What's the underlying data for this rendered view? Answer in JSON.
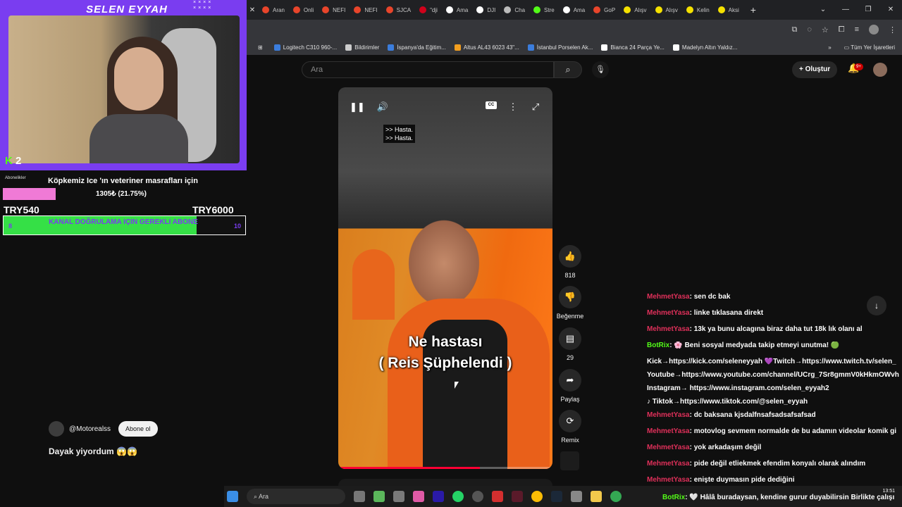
{
  "browser": {
    "tabs": [
      "Aran",
      "Onli",
      "NEFI",
      "NEFI",
      "SJCA",
      "\"dji",
      "Ama",
      "DJI",
      "Cha",
      "Stre",
      "Ama",
      "GoP",
      "Alışv",
      "Alışv",
      "Kelin",
      "Aksi"
    ],
    "tab_colors": [
      "#e8452b",
      "#e8452b",
      "#e8452b",
      "#e8452b",
      "#e8452b",
      "#d0021b",
      "#ffffff",
      "#ffffff",
      "#bbbbbb",
      "#53fc18",
      "#ffffff",
      "#e8452b",
      "#f5e100",
      "#f5e100",
      "#f5e100",
      "#f5e100"
    ],
    "new_tab": "+",
    "bookmarks": [
      "Logitech C310 960-...",
      "Bildirimler",
      "İspanya'da Eğitim...",
      "Altus AL43 6023 43\"...",
      "İstanbul Porselen Ak...",
      "Bianca 24 Parça Ye...",
      "Madelyn Altın Yaldız..."
    ],
    "bookmark_colors": [
      "#3b7ddd",
      "#cccccc",
      "#3b7ddd",
      "#f29e1f",
      "#3b7ddd",
      "#ffffff",
      "#ffffff"
    ],
    "all_bookmarks": "Tüm Yer İşaretleri"
  },
  "youtube": {
    "search_placeholder": "Ara",
    "create_label": "Oluştur",
    "notif_count": "9+"
  },
  "video": {
    "small_sub_1": ">> Hasta.",
    "small_sub_2": ">> Hasta.",
    "caption_1": "Ne hastası",
    "caption_2": "( Reis Şüphelendi )",
    "cc": "CC",
    "progress": 0.66
  },
  "actions": {
    "likes": "818",
    "dislike_label": "Beğenme",
    "comments": "29",
    "share_label": "Paylaş",
    "remix_label": "Remix"
  },
  "overlay": {
    "streamer_name": "SELEN EYYAH",
    "viewer_count": "2",
    "subs_label": "Abonelikler",
    "goal_title": "Köpkemiz Ice 'ın veteriner masrafları için",
    "goal_progress": "1305₺ (21.75%)",
    "goal_fraction": 0.2175,
    "goal_min": "TRY540",
    "goal_max": "TRY6000",
    "sub_goal_text": "KANAL DOĞRULAMA IÇIN GEREKLI ABONE",
    "sub_goal_current": "8",
    "sub_goal_target": "10",
    "sub_goal_fraction": 0.8
  },
  "comment": {
    "handle": "@Motorealss",
    "subscribe_label": "Abone ol",
    "text": "Dayak yiyordum 😱😱"
  },
  "chat": [
    {
      "user": "MehmetYasa",
      "msg": ": sen dc bak"
    },
    {
      "user": "MehmetYasa",
      "msg": ": linke tıklasana direkt"
    },
    {
      "user": "MehmetYasa",
      "msg": ": 13k ya bunu alcagına biraz daha tut 18k lık olanı al"
    },
    {
      "user": "BotRix",
      "msg": ": 🌸 Beni sosyal medyada takip etmeyi unutma! 🟢",
      "bot": true
    },
    {
      "user": "",
      "msg": "Kick→https://kick.com/seleneyyah 💜Twitch→https://www.twitch.tv/selen_"
    },
    {
      "user": "",
      "msg": "Youtube→https://www.youtube.com/channel/UCrg_7Sr8gmmV0kHkmOWvh"
    },
    {
      "user": "",
      "msg": "Instagram→ https://www.instagram.com/selen_eyyah2"
    },
    {
      "user": "",
      "msg": "♪ Tiktok→https://www.tiktok.com/@selen_eyyah"
    },
    {
      "user": "MehmetYasa",
      "msg": ": dc baksana kjsdalfnsafsadsafsafsad"
    },
    {
      "user": "MehmetYasa",
      "msg": ": motovlog sevmem normalde de bu adamın videolar komik gi"
    },
    {
      "user": "MehmetYasa",
      "msg": ": yok arkadaşım değil"
    },
    {
      "user": "MehmetYasa",
      "msg": ": pide değil etliekmek efendim konyalı olarak alındım"
    },
    {
      "user": "MehmetYasa",
      "msg": ": enişte duymasın pide dediğini"
    }
  ],
  "taskbar": {
    "search": "Ara",
    "time": "13:51",
    "bot_user": "BotRix",
    "bot_msg": ": 🤍 Hâlâ buradaysan, kendine gurur duyabilirsin Birlikte çalışı"
  }
}
